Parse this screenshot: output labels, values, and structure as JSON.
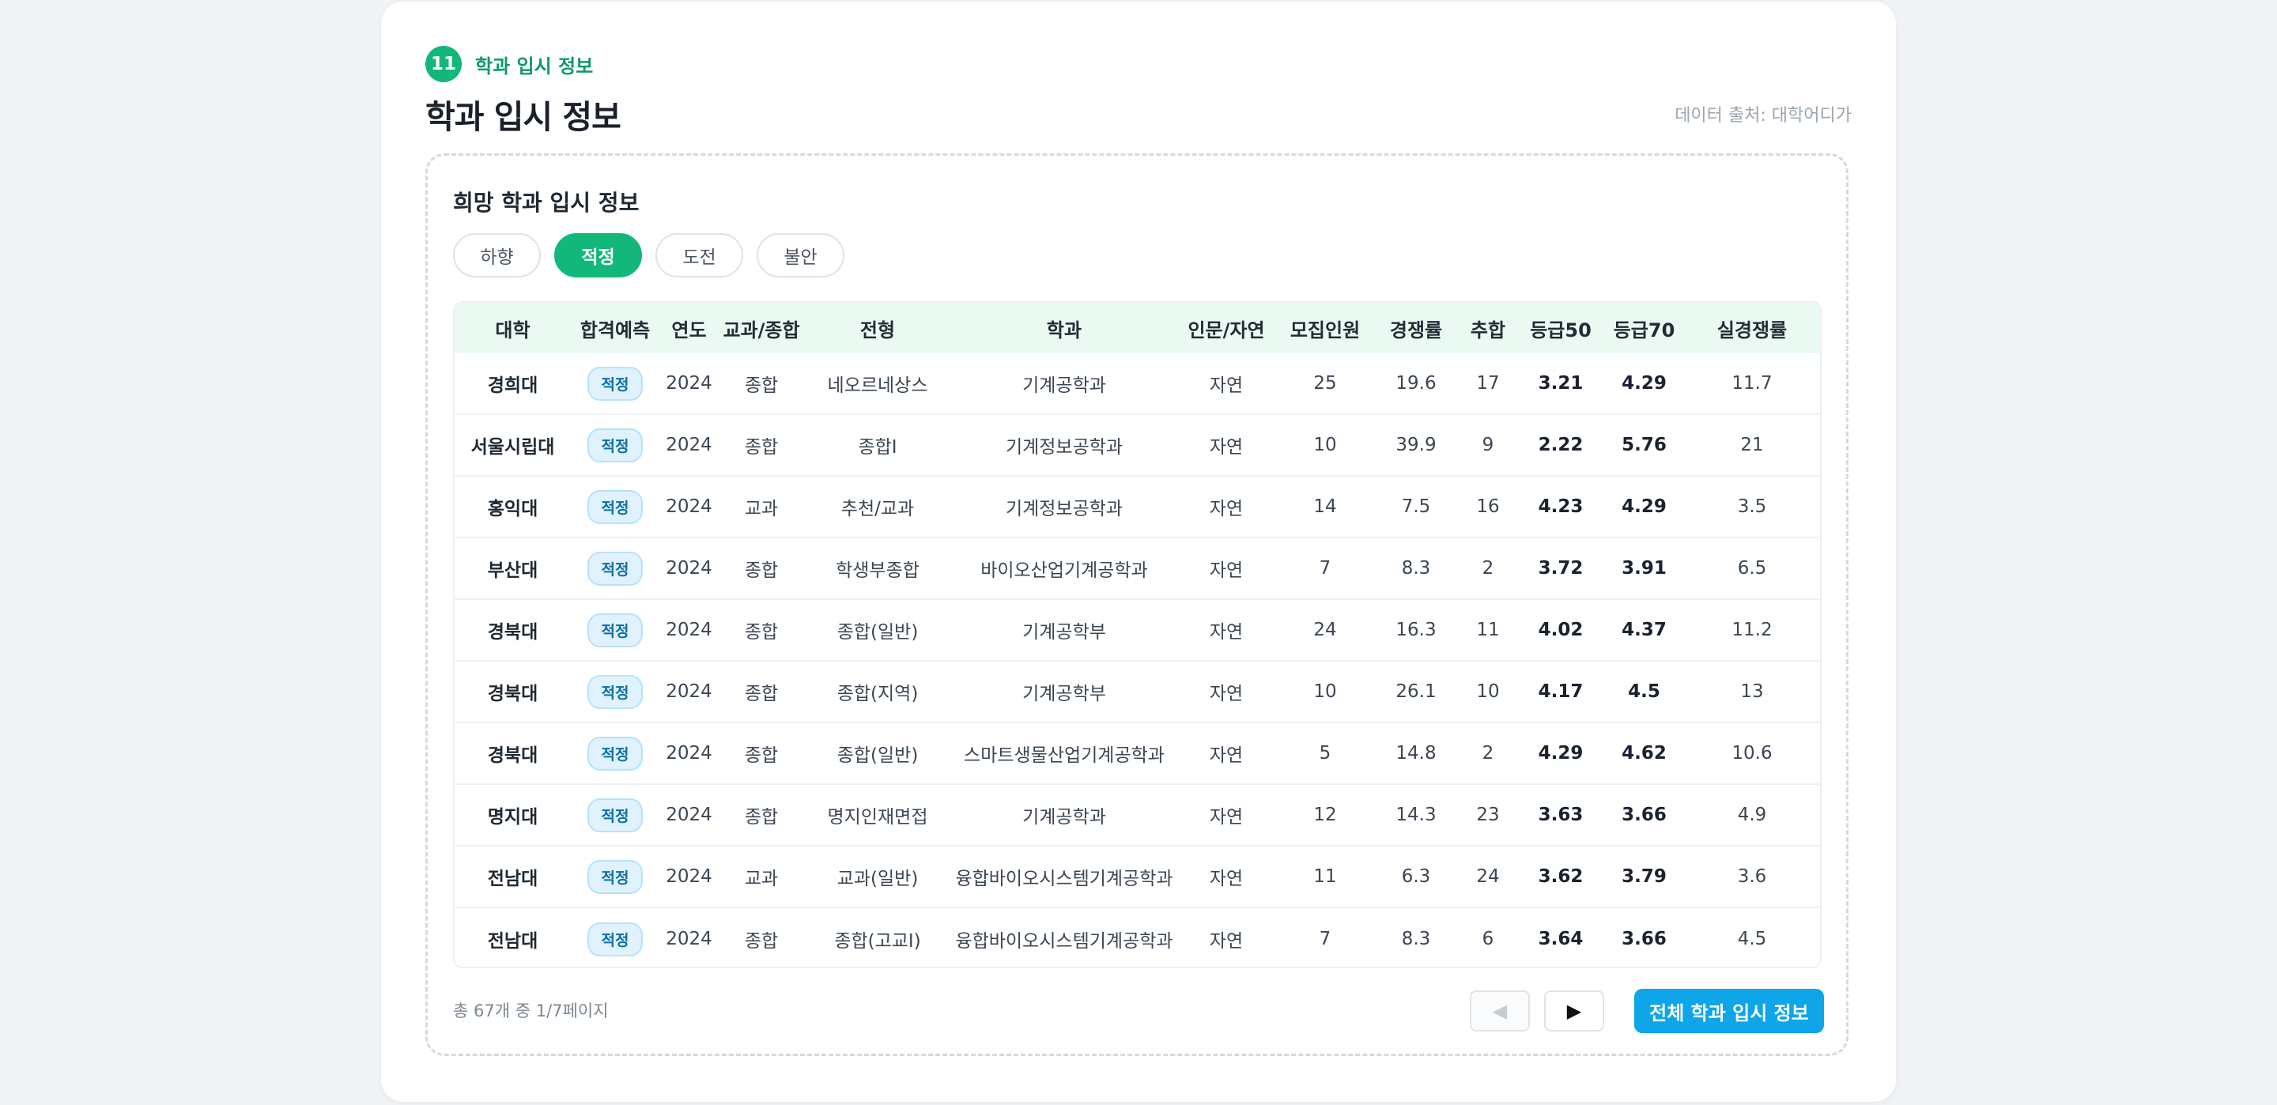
{
  "section": {
    "number": "11",
    "label": "학과 입시 정보"
  },
  "page_title": "학과 입시 정보",
  "source": "데이터 출처: 대학어디가",
  "panel_title": "희망 학과 입시 정보",
  "tabs": [
    {
      "label": "하향",
      "active": false
    },
    {
      "label": "적정",
      "active": true
    },
    {
      "label": "도전",
      "active": false
    },
    {
      "label": "불안",
      "active": false
    }
  ],
  "table": {
    "headers": [
      "대학",
      "합격예측",
      "연도",
      "교과/종합",
      "전형",
      "학과",
      "인문/자연",
      "모집인원",
      "경쟁률",
      "추합",
      "등급50",
      "등급70",
      "실경쟁률"
    ],
    "rows": [
      [
        "경희대",
        "적정",
        "2024",
        "종합",
        "네오르네상스",
        "기계공학과",
        "자연",
        "25",
        "19.6",
        "17",
        "3.21",
        "4.29",
        "11.7"
      ],
      [
        "서울시립대",
        "적정",
        "2024",
        "종합",
        "종합Ⅰ",
        "기계정보공학과",
        "자연",
        "10",
        "39.9",
        "9",
        "2.22",
        "5.76",
        "21"
      ],
      [
        "홍익대",
        "적정",
        "2024",
        "교과",
        "추천/교과",
        "기계정보공학과",
        "자연",
        "14",
        "7.5",
        "16",
        "4.23",
        "4.29",
        "3.5"
      ],
      [
        "부산대",
        "적정",
        "2024",
        "종합",
        "학생부종합",
        "바이오산업기계공학과",
        "자연",
        "7",
        "8.3",
        "2",
        "3.72",
        "3.91",
        "6.5"
      ],
      [
        "경북대",
        "적정",
        "2024",
        "종합",
        "종합(일반)",
        "기계공학부",
        "자연",
        "24",
        "16.3",
        "11",
        "4.02",
        "4.37",
        "11.2"
      ],
      [
        "경북대",
        "적정",
        "2024",
        "종합",
        "종합(지역)",
        "기계공학부",
        "자연",
        "10",
        "26.1",
        "10",
        "4.17",
        "4.5",
        "13"
      ],
      [
        "경북대",
        "적정",
        "2024",
        "종합",
        "종합(일반)",
        "스마트생물산업기계공학과",
        "자연",
        "5",
        "14.8",
        "2",
        "4.29",
        "4.62",
        "10.6"
      ],
      [
        "명지대",
        "적정",
        "2024",
        "종합",
        "명지인재면접",
        "기계공학과",
        "자연",
        "12",
        "14.3",
        "23",
        "3.63",
        "3.66",
        "4.9"
      ],
      [
        "전남대",
        "적정",
        "2024",
        "교과",
        "교과(일반)",
        "융합바이오시스템기계공학과",
        "자연",
        "11",
        "6.3",
        "24",
        "3.62",
        "3.79",
        "3.6"
      ],
      [
        "전남대",
        "적정",
        "2024",
        "종합",
        "종합(고교Ⅰ)",
        "융합바이오시스템기계공학과",
        "자연",
        "7",
        "8.3",
        "6",
        "3.64",
        "3.66",
        "4.5"
      ]
    ]
  },
  "footer": {
    "count_text": "총 67개 중 1/7페이지",
    "prev_icon": "◀",
    "next_icon": "▶",
    "all_button": "전체 학과 입시 정보"
  },
  "colors": {
    "accent": "#12b87a",
    "button": "#0ea5e9",
    "badge_bg": "#e0f2fe"
  }
}
